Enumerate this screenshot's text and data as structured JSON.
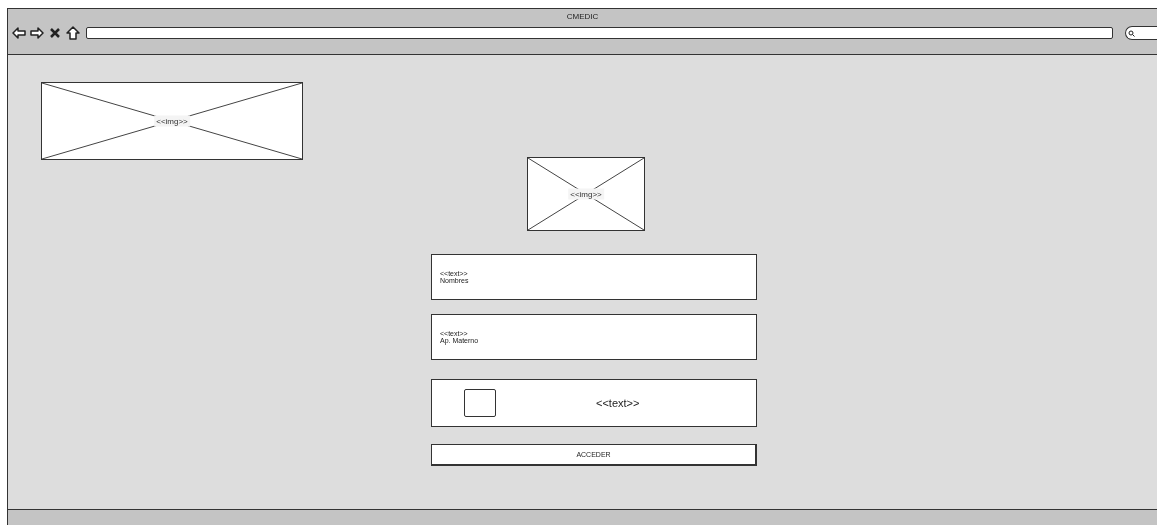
{
  "window": {
    "title": "CMEDIC"
  },
  "images": [
    {
      "label": "<<img>>"
    },
    {
      "label": "<<img>>"
    }
  ],
  "fields": [
    {
      "hint": "<<text>>",
      "value": "Nombres"
    },
    {
      "hint": "<<text>>",
      "value": "Ap. Materno"
    }
  ],
  "captcha": {
    "checked": false,
    "label": "<<text>>"
  },
  "button": {
    "label": "ACCEDER"
  }
}
